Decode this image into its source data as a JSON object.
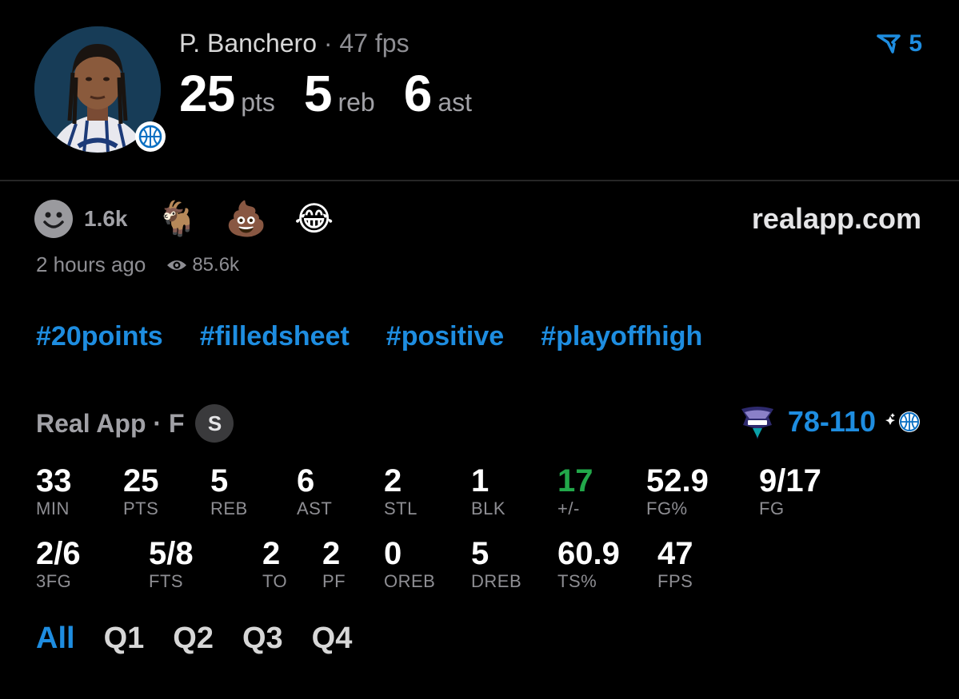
{
  "player": {
    "name": "P. Banchero",
    "separator": "·",
    "fps_text": "47 fps",
    "points": "25",
    "points_unit": "pts",
    "rebounds": "5",
    "rebounds_unit": "reb",
    "assists": "6",
    "assists_unit": "ast"
  },
  "boost": {
    "icon": "boost-arrow-icon",
    "count": "5",
    "color": "#1e8de0"
  },
  "reactions": {
    "count": "1.6k",
    "emojis": [
      "🐐",
      "💩",
      "😂"
    ]
  },
  "site": "realapp.com",
  "meta": {
    "time": "2 hours ago",
    "views": "85.6k"
  },
  "tags": [
    "#20points",
    "#filledsheet",
    "#positive",
    "#playoffhigh"
  ],
  "game": {
    "source": "Real App · F",
    "badge": "S",
    "score": "78-110"
  },
  "box": [
    {
      "value": "33",
      "label": "MIN"
    },
    {
      "value": "25",
      "label": "PTS"
    },
    {
      "value": "5",
      "label": "REB"
    },
    {
      "value": "6",
      "label": "AST"
    },
    {
      "value": "2",
      "label": "STL"
    },
    {
      "value": "1",
      "label": "BLK"
    },
    {
      "value": "17",
      "label": "+/-"
    },
    {
      "value": "52.9",
      "label": "FG%"
    },
    {
      "value": "9/17",
      "label": "FG"
    },
    {
      "value": "2/6",
      "label": "3FG"
    },
    {
      "value": "5/8",
      "label": "FTS"
    },
    {
      "value": "2",
      "label": "TO"
    },
    {
      "value": "2",
      "label": "PF"
    },
    {
      "value": "0",
      "label": "OREB"
    },
    {
      "value": "5",
      "label": "DREB"
    },
    {
      "value": "60.9",
      "label": "TS%"
    },
    {
      "value": "47",
      "label": "FPS"
    }
  ],
  "quarters": [
    "All",
    "Q1",
    "Q2",
    "Q3",
    "Q4"
  ],
  "colors": {
    "accent": "#1e8de0",
    "positive": "#22a84a",
    "background": "#000000"
  }
}
